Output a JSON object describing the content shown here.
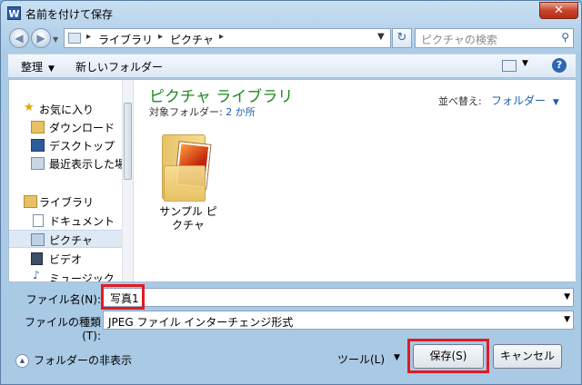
{
  "window": {
    "title": "名前を付けて保存",
    "close": "✕",
    "app_icon": "W"
  },
  "nav": {
    "back_icon": "back-arrow-icon",
    "forward_icon": "forward-arrow-icon",
    "breadcrumbs": [
      "ライブラリ",
      "ピクチャ"
    ],
    "search_placeholder": "ピクチャの検索"
  },
  "toolbar": {
    "organize": "整理",
    "new_folder": "新しいフォルダー"
  },
  "sidebar": {
    "items": [
      {
        "label": "お気に入り",
        "icon": "star-icon",
        "header": true
      },
      {
        "label": "ダウンロード",
        "icon": "download-folder-icon"
      },
      {
        "label": "デスクトップ",
        "icon": "desktop-icon"
      },
      {
        "label": "最近表示した場所",
        "icon": "recent-places-icon"
      },
      {
        "label": "ライブラリ",
        "icon": "library-icon",
        "header": true
      },
      {
        "label": "ドキュメント",
        "icon": "documents-icon"
      },
      {
        "label": "ピクチャ",
        "icon": "pictures-icon",
        "selected": true
      },
      {
        "label": "ビデオ",
        "icon": "video-icon"
      },
      {
        "label": "ミュージック",
        "icon": "music-icon"
      }
    ]
  },
  "content": {
    "library_title": "ピクチャ ライブラリ",
    "target_label": "対象フォルダー:",
    "target_count": "2 か所",
    "sort_label": "並べ替え:",
    "sort_value": "フォルダー",
    "folders": [
      {
        "name": "サンプル ピクチャ"
      }
    ]
  },
  "form": {
    "filename_label": "ファイル名(N):",
    "filename_value": "写真1",
    "filetype_label": "ファイルの種類(T):",
    "filetype_value": "JPEG ファイル インターチェンジ形式"
  },
  "footer": {
    "hide_folders": "フォルダーの非表示",
    "tools": "ツール(L)",
    "save": "保存(S)",
    "cancel": "キャンセル"
  },
  "colors": {
    "highlight": "#e01b24",
    "library_title": "#1e8a1e",
    "link": "#1a5fb4"
  }
}
